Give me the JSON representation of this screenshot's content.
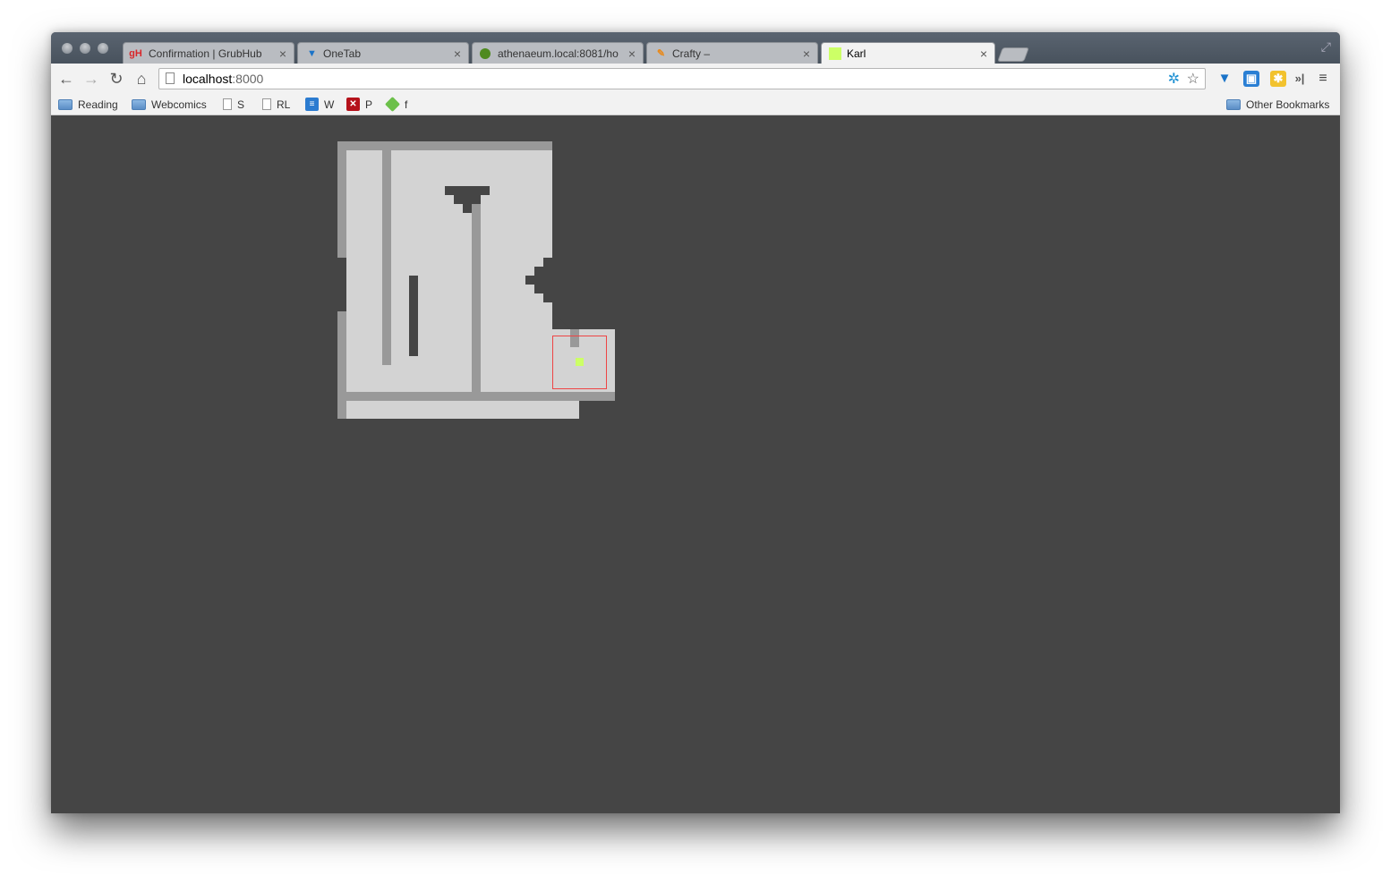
{
  "browser": {
    "tabs": [
      {
        "title": "Confirmation | GrubHub",
        "favicon": "grubhub-icon",
        "active": false
      },
      {
        "title": "OneTab",
        "favicon": "onetab-icon",
        "active": false
      },
      {
        "title": "athenaeum.local:8081/ho",
        "favicon": "athenaeum-icon",
        "active": false
      },
      {
        "title": "Crafty –",
        "favicon": "crafty-icon",
        "active": false
      },
      {
        "title": "Karl",
        "favicon": "karl-square-icon",
        "active": true
      }
    ],
    "close_glyph": "×",
    "address": {
      "host": "localhost",
      "port": ":8000"
    },
    "bookmarks": [
      {
        "label": "Reading",
        "icon": "folder-icon"
      },
      {
        "label": "Webcomics",
        "icon": "folder-icon"
      },
      {
        "label": "S",
        "icon": "page-icon"
      },
      {
        "label": "RL",
        "icon": "page-icon"
      },
      {
        "label": "W",
        "icon": "w-bookmark-icon"
      },
      {
        "label": "P",
        "icon": "pin-bookmark-icon"
      },
      {
        "label": "f",
        "icon": "feedly-icon"
      }
    ],
    "other_bookmarks": "Other Bookmarks",
    "overflow_glyph": "»"
  },
  "colors": {
    "background": "#454545",
    "floor": "#d3d3d3",
    "wall": "#999999",
    "player": "#ccff66",
    "viewport_border": "#ee4444"
  }
}
